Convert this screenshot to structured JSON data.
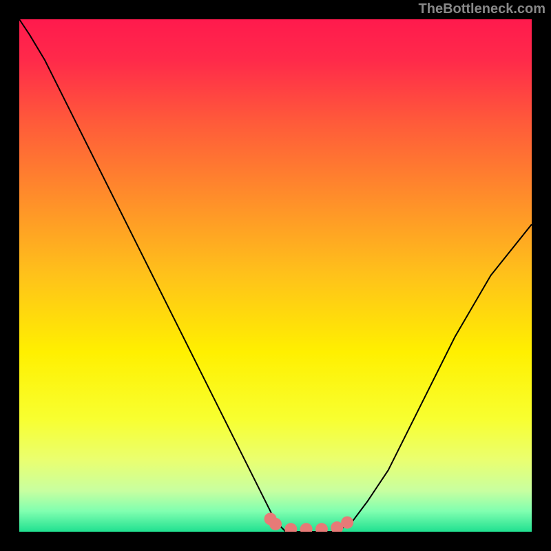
{
  "watermark": "TheBottleneck.com",
  "chart_data": {
    "type": "line",
    "title": "",
    "xlabel": "",
    "ylabel": "",
    "xlim": [
      0,
      100
    ],
    "ylim": [
      0,
      100
    ],
    "series": [
      {
        "name": "curve",
        "x": [
          0,
          2,
          5,
          8,
          12,
          16,
          20,
          25,
          30,
          35,
          40,
          45,
          48,
          50,
          52,
          55,
          58,
          62,
          65,
          68,
          72,
          78,
          85,
          92,
          100
        ],
        "y": [
          100,
          97,
          92,
          86,
          78,
          70,
          62,
          52,
          42,
          32,
          22,
          12,
          6,
          2,
          0,
          0,
          0,
          0,
          2,
          6,
          12,
          24,
          38,
          50,
          60
        ]
      },
      {
        "name": "markers",
        "x": [
          49,
          50,
          53,
          56,
          59,
          62,
          64
        ],
        "y": [
          2.5,
          1.5,
          0.5,
          0.5,
          0.5,
          0.8,
          1.8
        ]
      }
    ],
    "gradient_stops": [
      {
        "offset": 0.0,
        "color": "#ff1a4d"
      },
      {
        "offset": 0.08,
        "color": "#ff2a4a"
      },
      {
        "offset": 0.2,
        "color": "#ff5a3a"
      },
      {
        "offset": 0.35,
        "color": "#ff8e2a"
      },
      {
        "offset": 0.5,
        "color": "#ffc21a"
      },
      {
        "offset": 0.65,
        "color": "#fff000"
      },
      {
        "offset": 0.78,
        "color": "#f8ff30"
      },
      {
        "offset": 0.86,
        "color": "#eaff70"
      },
      {
        "offset": 0.92,
        "color": "#c8ffa0"
      },
      {
        "offset": 0.96,
        "color": "#80ffb0"
      },
      {
        "offset": 1.0,
        "color": "#20e090"
      }
    ],
    "marker_color": "#e77a77"
  }
}
